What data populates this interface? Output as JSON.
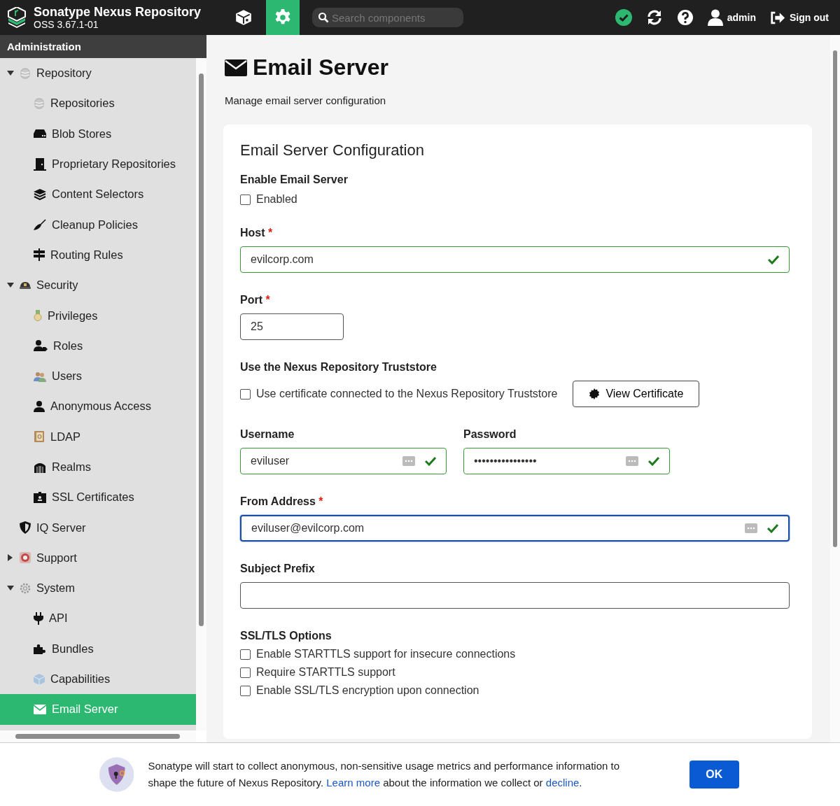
{
  "header": {
    "product": "Sonatype Nexus Repository",
    "version": "OSS 3.67.1-01",
    "modes": [
      {
        "kind": "browse",
        "selected": false
      },
      {
        "kind": "admin",
        "selected": true
      }
    ],
    "search": {
      "placeholder": "Search components"
    },
    "user": "admin",
    "sign_out": "Sign out"
  },
  "sidebar": {
    "title": "Administration",
    "items": [
      {
        "label": "Repository",
        "expanded": true,
        "selected": false,
        "children": [
          {
            "label": "Repositories",
            "selected": false
          },
          {
            "label": "Blob Stores",
            "selected": false
          },
          {
            "label": "Proprietary Repositories",
            "selected": false
          },
          {
            "label": "Content Selectors",
            "selected": false
          },
          {
            "label": "Cleanup Policies",
            "selected": false
          },
          {
            "label": "Routing Rules",
            "selected": false
          }
        ]
      },
      {
        "label": "Security",
        "expanded": true,
        "selected": false,
        "children": [
          {
            "label": "Privileges",
            "selected": false
          },
          {
            "label": "Roles",
            "selected": false
          },
          {
            "label": "Users",
            "selected": false
          },
          {
            "label": "Anonymous Access",
            "selected": false
          },
          {
            "label": "LDAP",
            "selected": false
          },
          {
            "label": "Realms",
            "selected": false
          },
          {
            "label": "SSL Certificates",
            "selected": false
          }
        ]
      },
      {
        "label": "IQ Server",
        "selected": false
      },
      {
        "label": "Support",
        "expanded": false,
        "selected": false
      },
      {
        "label": "System",
        "expanded": true,
        "selected": false,
        "children": [
          {
            "label": "API",
            "selected": false
          },
          {
            "label": "Bundles",
            "selected": false
          },
          {
            "label": "Capabilities",
            "selected": false
          },
          {
            "label": "Email Server",
            "selected": true
          }
        ]
      }
    ]
  },
  "page": {
    "title": "Email Server",
    "subtitle": "Manage email server configuration"
  },
  "form": {
    "title": "Email Server Configuration",
    "enable": {
      "label": "Enable Email Server",
      "checkbox": {
        "label": "Enabled",
        "checked": false
      }
    },
    "host": {
      "label": "Host",
      "required_mark": "*",
      "value": "evilcorp.com",
      "valid": true,
      "focused": false
    },
    "port": {
      "label": "Port",
      "required_mark": "*",
      "value": "25",
      "valid": false,
      "focused": false
    },
    "truststore": {
      "label": "Use the Nexus Repository Truststore",
      "checkbox": {
        "label": "Use certificate connected to the Nexus Repository Truststore",
        "checked": false
      },
      "button": "View Certificate"
    },
    "username": {
      "label": "Username",
      "value": "eviluser",
      "valid": true,
      "focused": false,
      "autofill": true
    },
    "password": {
      "label": "Password",
      "value": "••••••••••••••••",
      "valid": true,
      "focused": false,
      "autofill": true
    },
    "from_address": {
      "label": "From Address",
      "required_mark": "*",
      "value": "eviluser@evilcorp.com",
      "valid": true,
      "focused": true,
      "autofill": true
    },
    "subject_prefix": {
      "label": "Subject Prefix",
      "valid": false,
      "focused": false
    },
    "ssl": {
      "label": "SSL/TLS Options",
      "options": [
        {
          "label": "Enable STARTTLS support for insecure connections",
          "checked": false
        },
        {
          "label": "Require STARTTLS support",
          "checked": false
        },
        {
          "label": "Enable SSL/TLS encryption upon connection",
          "checked": false
        }
      ]
    }
  },
  "notice": {
    "parts": [
      {
        "kind": "text",
        "text": "Sonatype will start to collect anonymous, non-sensitive usage metrics and performance information to shape the future of Nexus Repository."
      },
      {
        "kind": "link",
        "text": "Learn more"
      },
      {
        "kind": "text",
        "text": "about the information we collect or"
      },
      {
        "kind": "link",
        "text": "decline"
      },
      {
        "kind": "text",
        "text": "."
      }
    ],
    "button": "OK"
  }
}
